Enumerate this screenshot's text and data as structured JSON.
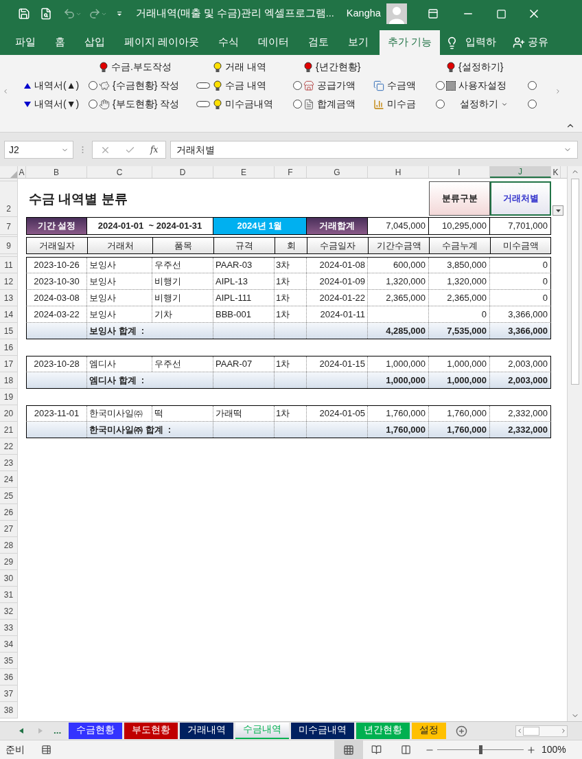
{
  "window": {
    "title": "거래내역(매출 및 수금)관리 엑셀프로그램...",
    "user": "Kangha"
  },
  "ribbon_tabs": [
    {
      "label": "파일",
      "selected": false
    },
    {
      "label": "홈",
      "selected": false
    },
    {
      "label": "삽입",
      "selected": false
    },
    {
      "label": "페이지 레이아웃",
      "selected": false
    },
    {
      "label": "수식",
      "selected": false
    },
    {
      "label": "데이터",
      "selected": false
    },
    {
      "label": "검토",
      "selected": false
    },
    {
      "label": "보기",
      "selected": false
    },
    {
      "label": "추가 기능",
      "selected": true
    }
  ],
  "tell_me": "입력하",
  "share": "공유",
  "ribbon": {
    "rows": [
      [
        null,
        null,
        {
          "kind": "bulb-red",
          "label": "수금.부도작성"
        },
        null,
        {
          "kind": "bulb-yellow",
          "label": "거래 내역"
        },
        null,
        {
          "kind": "bulb-red",
          "label": "{년간현황}"
        },
        null,
        null,
        {
          "kind": "bulb-red",
          "label": "{설정하기}"
        },
        null
      ],
      [
        {
          "kind": "arrow-up",
          "label": "내역서(▲)"
        },
        {
          "kind": "radio",
          "selected": false
        },
        {
          "kind": "piggy",
          "label": "{수금현황} 작성"
        },
        {
          "kind": "toggle"
        },
        {
          "kind": "bulb-yellow",
          "label": "수금 내역"
        },
        {
          "kind": "radio",
          "selected": false
        },
        {
          "kind": "store",
          "label": "공급가액"
        },
        {
          "kind": "copy",
          "label": "수금액"
        },
        {
          "kind": "radio",
          "selected": false
        },
        {
          "kind": "square",
          "label": "사용자설정"
        },
        {
          "kind": "radio",
          "selected": false
        }
      ],
      [
        {
          "kind": "arrow-down",
          "label": "내역서(▼)"
        },
        {
          "kind": "radio",
          "selected": false
        },
        {
          "kind": "hand",
          "label": "{부도현황} 작성"
        },
        {
          "kind": "toggle"
        },
        {
          "kind": "bulb-yellow",
          "label": "미수금내역"
        },
        {
          "kind": "radio",
          "selected": false
        },
        {
          "kind": "document",
          "label": "합계금액"
        },
        {
          "kind": "chart",
          "label": "미수금"
        },
        {
          "kind": "radio",
          "selected": false
        },
        {
          "kind": "dropdown",
          "label": "설정하기"
        },
        {
          "kind": "radio",
          "selected": false
        }
      ]
    ]
  },
  "formula_bar": {
    "name_box": "J2",
    "function_label": "fx",
    "formula": "거래처별"
  },
  "columns": [
    {
      "label": "A",
      "selected": false
    },
    {
      "label": "B",
      "selected": false
    },
    {
      "label": "C",
      "selected": false
    },
    {
      "label": "D",
      "selected": false
    },
    {
      "label": "E",
      "selected": false
    },
    {
      "label": "F",
      "selected": false
    },
    {
      "label": "G",
      "selected": false
    },
    {
      "label": "H",
      "selected": false
    },
    {
      "label": "I",
      "selected": false
    },
    {
      "label": "J",
      "selected": true
    },
    {
      "label": "K",
      "selected": false
    }
  ],
  "sheet": {
    "title_row": {
      "row": "2",
      "title": "수금 내역별 분류",
      "button": "분류구분",
      "value": "거래처별"
    },
    "period_row": {
      "row": "7",
      "label": "기간 설정",
      "range": "2024-01-01  ~ 2024-01-31",
      "month": "2024년 1월",
      "total_label": "거래합계",
      "totals": [
        "7,045,000",
        "10,295,000",
        "7,701,000"
      ]
    },
    "header_row": {
      "row": "9",
      "headers": [
        "거래일자",
        "거래처",
        "품목",
        "규격",
        "회",
        "수금일자",
        "기간수금액",
        "수금누계",
        "미수금액"
      ]
    },
    "rows": [
      {
        "kind": "data",
        "row": "11",
        "cells": [
          "2023-10-26",
          "보잉사",
          "우주선",
          "PAAR-03",
          "3차",
          "2024-01-08",
          "600,000",
          "3,850,000",
          "0"
        ]
      },
      {
        "kind": "data",
        "row": "12",
        "cells": [
          "2023-10-30",
          "보잉사",
          "비행기",
          "AIPL-13",
          "1차",
          "2024-01-09",
          "1,320,000",
          "1,320,000",
          "0"
        ]
      },
      {
        "kind": "data",
        "row": "13",
        "cells": [
          "2024-03-08",
          "보잉사",
          "비행기",
          "AIPL-111",
          "1차",
          "2024-01-22",
          "2,365,000",
          "2,365,000",
          "0"
        ]
      },
      {
        "kind": "data",
        "row": "14",
        "cells": [
          "2024-03-22",
          "보잉사",
          "기차",
          "BBB-001",
          "1차",
          "2024-01-11",
          null,
          "0",
          "3,366,000"
        ]
      },
      {
        "kind": "total",
        "row": "15",
        "label": "보잉사 합계  :",
        "values": [
          "4,285,000",
          "7,535,000",
          "3,366,000"
        ]
      },
      {
        "kind": "blank",
        "row": "16"
      },
      {
        "kind": "data",
        "row": "17",
        "cells": [
          "2023-10-28",
          "엠디사",
          "우주선",
          "PAAR-07",
          "1차",
          "2024-01-15",
          "1,000,000",
          "1,000,000",
          "2,003,000"
        ]
      },
      {
        "kind": "total",
        "row": "18",
        "label": "엠디사 합계  :",
        "values": [
          "1,000,000",
          "1,000,000",
          "2,003,000"
        ]
      },
      {
        "kind": "blank",
        "row": "19"
      },
      {
        "kind": "data",
        "row": "20",
        "cells": [
          "2023-11-01",
          "한국미사일㈜",
          "떡",
          "가래떡",
          "1차",
          "2024-01-05",
          "1,760,000",
          "1,760,000",
          "2,332,000"
        ]
      },
      {
        "kind": "total",
        "row": "21",
        "label": "한국미사일㈜ 합계  :",
        "values": [
          "1,760,000",
          "1,760,000",
          "2,332,000"
        ]
      },
      {
        "kind": "blank",
        "row": "22"
      },
      {
        "kind": "blank",
        "row": "23"
      },
      {
        "kind": "blank",
        "row": "24"
      },
      {
        "kind": "blank",
        "row": "25"
      },
      {
        "kind": "blank",
        "row": "26"
      },
      {
        "kind": "blank",
        "row": "27"
      },
      {
        "kind": "blank",
        "row": "28"
      },
      {
        "kind": "blank",
        "row": "29"
      },
      {
        "kind": "blank",
        "row": "30"
      },
      {
        "kind": "blank",
        "row": "31"
      },
      {
        "kind": "blank",
        "row": "32"
      },
      {
        "kind": "blank",
        "row": "33"
      },
      {
        "kind": "blank",
        "row": "34"
      },
      {
        "kind": "blank",
        "row": "35"
      },
      {
        "kind": "blank",
        "row": "36"
      },
      {
        "kind": "blank",
        "row": "37"
      },
      {
        "kind": "blank",
        "row": "38"
      }
    ]
  },
  "sheet_tabs": {
    "more": "...",
    "tabs": [
      {
        "label": "수금현황",
        "color": "#3333ff",
        "selected": false
      },
      {
        "label": "부도현황",
        "color": "#c00000",
        "selected": false
      },
      {
        "label": "거래내역",
        "color": "#002060",
        "selected": false
      },
      {
        "label": "수금내역",
        "color": "#00b050",
        "selected": true
      },
      {
        "label": "미수금내역",
        "color": "#002060",
        "selected": false
      },
      {
        "label": "년간현황",
        "color": "#00b050",
        "selected": false
      },
      {
        "label": "설정",
        "color": "#ffc000",
        "selected": false
      }
    ]
  },
  "status_bar": {
    "mode": "준비",
    "zoom": "100%",
    "zoom_slider": {
      "level": 0.5
    }
  }
}
